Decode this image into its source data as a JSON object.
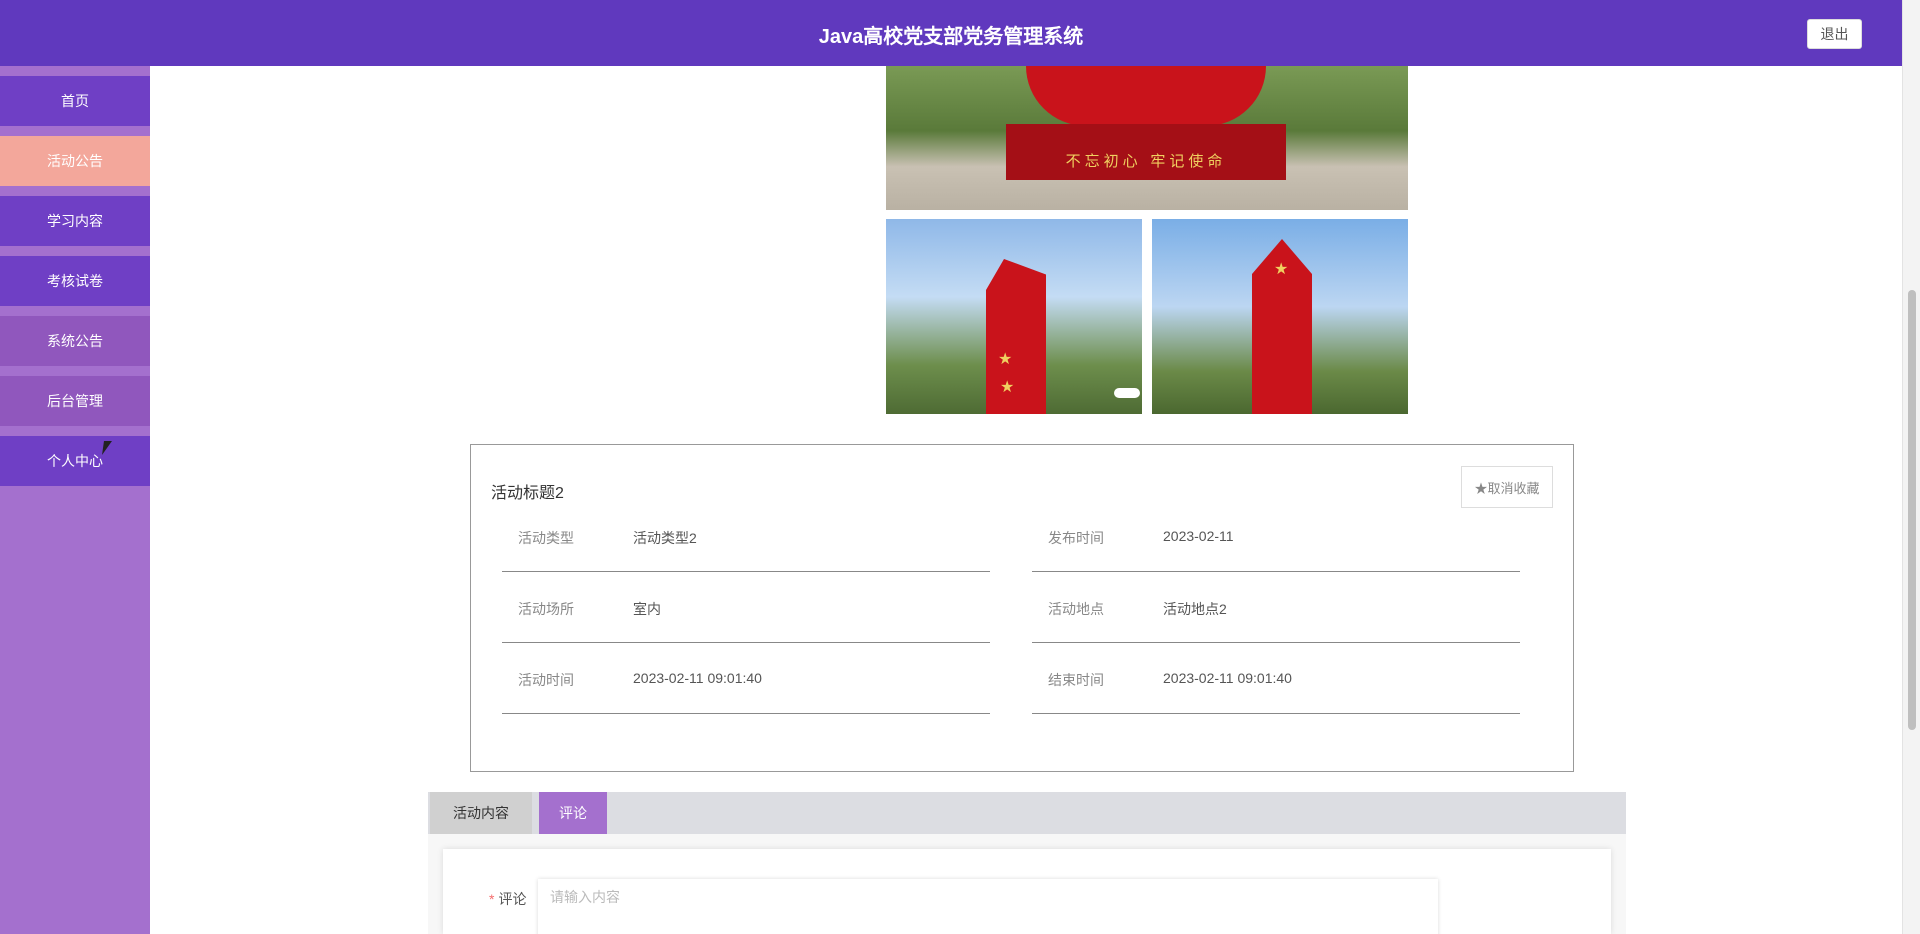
{
  "header": {
    "title": "Java高校党支部党务管理系统",
    "logout_label": "退出",
    "color": "#6039BE"
  },
  "sidebar": {
    "color": "#A470CE",
    "items": [
      {
        "label": "首页",
        "color": "#6F3FC5"
      },
      {
        "label": "活动公告",
        "color": "#F3A79B",
        "active": true
      },
      {
        "label": "学习内容",
        "color": "#6F3FC5"
      },
      {
        "label": "考核试卷",
        "color": "#6F3FC5"
      },
      {
        "label": "系统公告",
        "color": "#9057BD"
      },
      {
        "label": "后台管理",
        "color": "#9057BD"
      },
      {
        "label": "个人中心",
        "color": "#6F3FC5"
      }
    ]
  },
  "carousel": {
    "slogan": "不忘初心 牢记使命"
  },
  "detail": {
    "title": "活动标题2",
    "favorite_label": "取消收藏",
    "fields": [
      {
        "label": "活动类型",
        "value": "活动类型2"
      },
      {
        "label": "发布时间",
        "value": "2023-02-11"
      },
      {
        "label": "活动场所",
        "value": "室内"
      },
      {
        "label": "活动地点",
        "value": "活动地点2"
      },
      {
        "label": "活动时间",
        "value": "2023-02-11 09:01:40"
      },
      {
        "label": "结束时间",
        "value": "2023-02-11 09:01:40"
      }
    ]
  },
  "tabs": [
    {
      "label": "活动内容",
      "active": false
    },
    {
      "label": "评论",
      "active": true
    }
  ],
  "comment": {
    "label": "评论",
    "required_mark": "*",
    "placeholder": "请输入内容"
  }
}
